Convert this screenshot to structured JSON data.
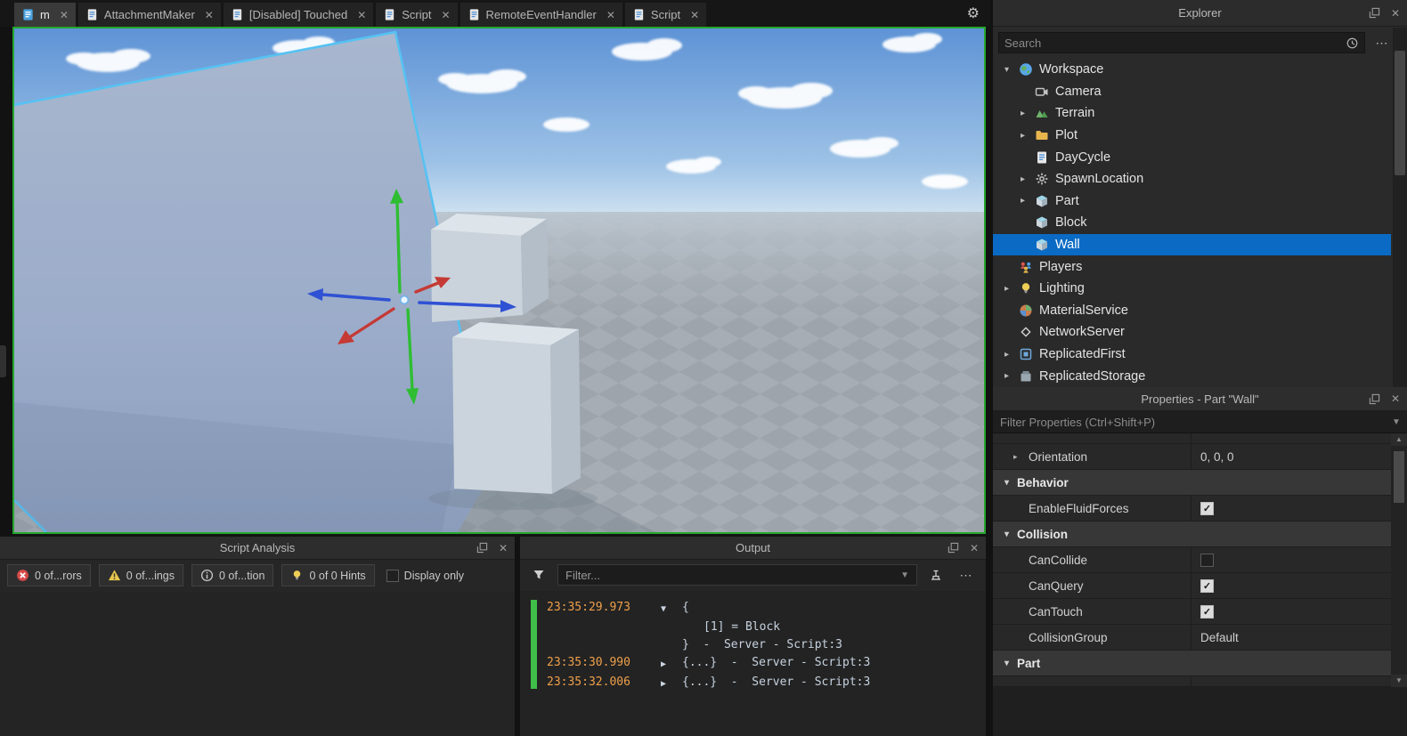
{
  "colors": {
    "selection_highlight": "#0b6bc4",
    "session_border_green": "#24a72c",
    "selection_outline_3d": "#56c2f2",
    "gizmo_x_color": "#c53a35",
    "gizmo_y_color": "#2fbd33",
    "gizmo_z_color": "#2f51d4",
    "output_timestamp_color": "#efa04a",
    "output_server_bar_green": "#3fbf49"
  },
  "tab_bar": {
    "tabs": [
      {
        "label": "m",
        "icon": "place-icon",
        "active": true
      },
      {
        "label": "AttachmentMaker",
        "icon": "script-icon",
        "active": false
      },
      {
        "label": "[Disabled] Touched",
        "icon": "script-icon",
        "active": false
      },
      {
        "label": "Script",
        "icon": "script-icon",
        "active": false
      },
      {
        "label": "RemoteEventHandler",
        "icon": "script-icon",
        "active": false
      },
      {
        "label": "Script",
        "icon": "script-icon",
        "active": false
      }
    ]
  },
  "viewport": {
    "selected_object": "Wall",
    "tool": "move"
  },
  "explorer": {
    "title": "Explorer",
    "search_placeholder": "Search",
    "tree": [
      {
        "label": "Workspace",
        "icon": "workspace-icon",
        "depth": 0,
        "arrow": "expanded",
        "selected": false
      },
      {
        "label": "Camera",
        "icon": "camera-icon",
        "depth": 1,
        "arrow": "none",
        "selected": false
      },
      {
        "label": "Terrain",
        "icon": "terrain-icon",
        "depth": 1,
        "arrow": "collapsed",
        "selected": false
      },
      {
        "label": "Plot",
        "icon": "folder-icon",
        "depth": 1,
        "arrow": "collapsed",
        "selected": false
      },
      {
        "label": "DayCycle",
        "icon": "script-icon",
        "depth": 1,
        "arrow": "none",
        "selected": false
      },
      {
        "label": "SpawnLocation",
        "icon": "spawn-location-icon",
        "depth": 1,
        "arrow": "collapsed",
        "selected": false
      },
      {
        "label": "Part",
        "icon": "part-icon",
        "depth": 1,
        "arrow": "collapsed",
        "selected": false
      },
      {
        "label": "Block",
        "icon": "part-icon",
        "depth": 1,
        "arrow": "none",
        "selected": false
      },
      {
        "label": "Wall",
        "icon": "part-icon",
        "depth": 1,
        "arrow": "none",
        "selected": true
      },
      {
        "label": "Players",
        "icon": "players-icon",
        "depth": 0,
        "arrow": "none",
        "selected": false
      },
      {
        "label": "Lighting",
        "icon": "lighting-icon",
        "depth": 0,
        "arrow": "collapsed",
        "selected": false
      },
      {
        "label": "MaterialService",
        "icon": "material-service-icon",
        "depth": 0,
        "arrow": "none",
        "selected": false
      },
      {
        "label": "NetworkServer",
        "icon": "network-server-icon",
        "depth": 0,
        "arrow": "none",
        "selected": false
      },
      {
        "label": "ReplicatedFirst",
        "icon": "replicated-first-icon",
        "depth": 0,
        "arrow": "collapsed",
        "selected": false
      },
      {
        "label": "ReplicatedStorage",
        "icon": "replicated-storage-icon",
        "depth": 0,
        "arrow": "collapsed",
        "selected": false
      }
    ]
  },
  "properties": {
    "title": "Properties - Part \"Wall\"",
    "filter_placeholder": "Filter Properties (Ctrl+Shift+P)",
    "rows": [
      {
        "type": "partial"
      },
      {
        "type": "prop",
        "name": "Orientation",
        "value": "0, 0, 0",
        "expandable": true
      },
      {
        "type": "section",
        "name": "Behavior"
      },
      {
        "type": "prop",
        "name": "EnableFluidForces",
        "checkbox": true,
        "checked": true
      },
      {
        "type": "section",
        "name": "Collision"
      },
      {
        "type": "prop",
        "name": "CanCollide",
        "checkbox": true,
        "checked": false
      },
      {
        "type": "prop",
        "name": "CanQuery",
        "checkbox": true,
        "checked": true
      },
      {
        "type": "prop",
        "name": "CanTouch",
        "checkbox": true,
        "checked": true
      },
      {
        "type": "prop",
        "name": "CollisionGroup",
        "value": "Default"
      },
      {
        "type": "section",
        "name": "Part"
      },
      {
        "type": "partial"
      }
    ]
  },
  "script_analysis": {
    "title": "Script Analysis",
    "filters": [
      {
        "label": "0 of...rors",
        "icon": "error-icon"
      },
      {
        "label": "0 of...ings",
        "icon": "warning-icon"
      },
      {
        "label": "0 of...tion",
        "icon": "info-icon"
      },
      {
        "label": "0 of 0 Hints",
        "icon": "hint-icon"
      }
    ],
    "display_only_label": "Display only"
  },
  "output": {
    "title": "Output",
    "filter_placeholder": "Filter...",
    "lines": [
      {
        "time": "23:35:29.973",
        "arrow": "▼",
        "text": "{",
        "indent": 0
      },
      {
        "time": "",
        "arrow": "",
        "text": "[1] = Block",
        "indent": 2
      },
      {
        "time": "",
        "arrow": "",
        "text": "}  -  Server - Script:3",
        "indent": 0
      },
      {
        "time": "23:35:30.990",
        "arrow": "▶",
        "text": "{...}  -  Server - Script:3",
        "indent": 0
      },
      {
        "time": "23:35:32.006",
        "arrow": "▶",
        "text": "{...}  -  Server - Script:3",
        "indent": 0
      }
    ]
  }
}
